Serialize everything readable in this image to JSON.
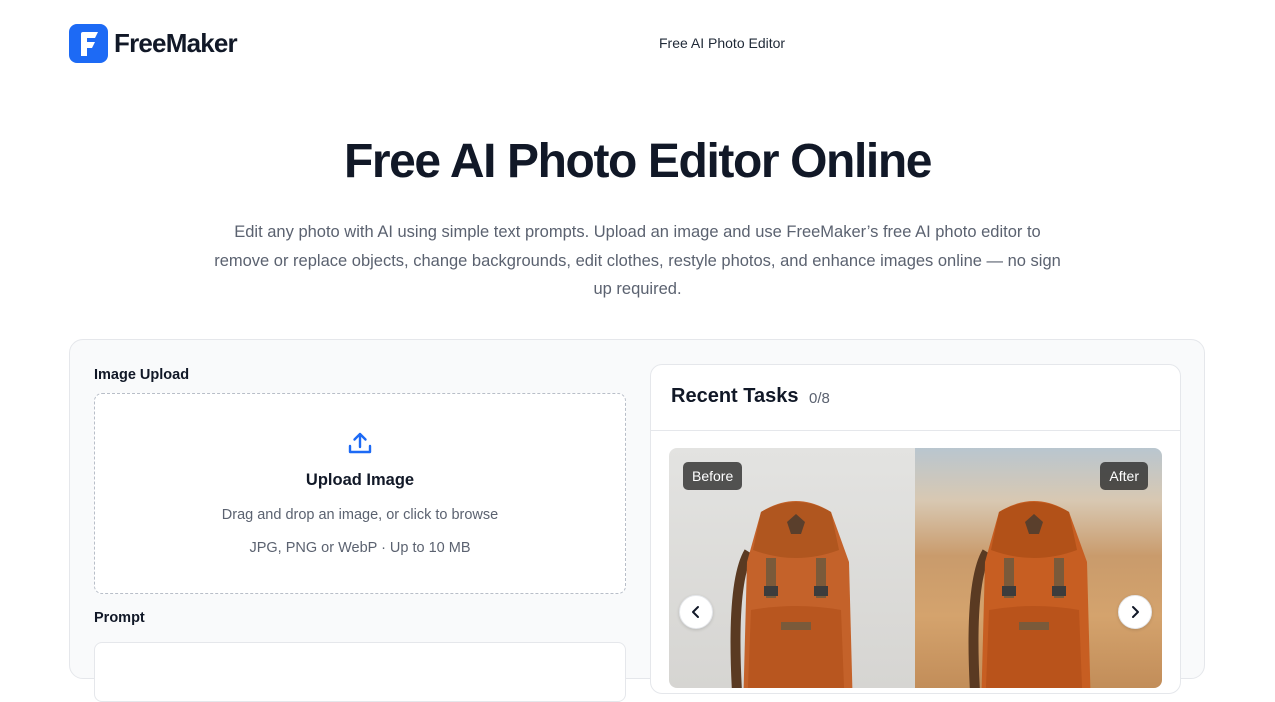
{
  "brand": {
    "name": "FreeMaker",
    "color": "#1d6af5"
  },
  "nav": {
    "link": "Free AI Photo Editor"
  },
  "hero": {
    "title": "Free AI Photo Editor Online",
    "subtitle": "Edit any photo with AI using simple text prompts. Upload an image and use FreeMaker’s free AI photo editor to remove or replace objects, change backgrounds, edit clothes, restyle photos, and enhance images online — no sign up required."
  },
  "upload": {
    "section_label": "Image Upload",
    "title": "Upload Image",
    "hint": "Drag and drop an image, or click to browse",
    "formats": "JPG, PNG or WebP · Up to 10 MB",
    "icon": "upload-icon"
  },
  "prompt": {
    "section_label": "Prompt"
  },
  "tasks": {
    "title": "Recent Tasks",
    "count": "0/8",
    "before_label": "Before",
    "after_label": "After",
    "prev_icon": "chevron-left-icon",
    "next_icon": "chevron-right-icon"
  }
}
